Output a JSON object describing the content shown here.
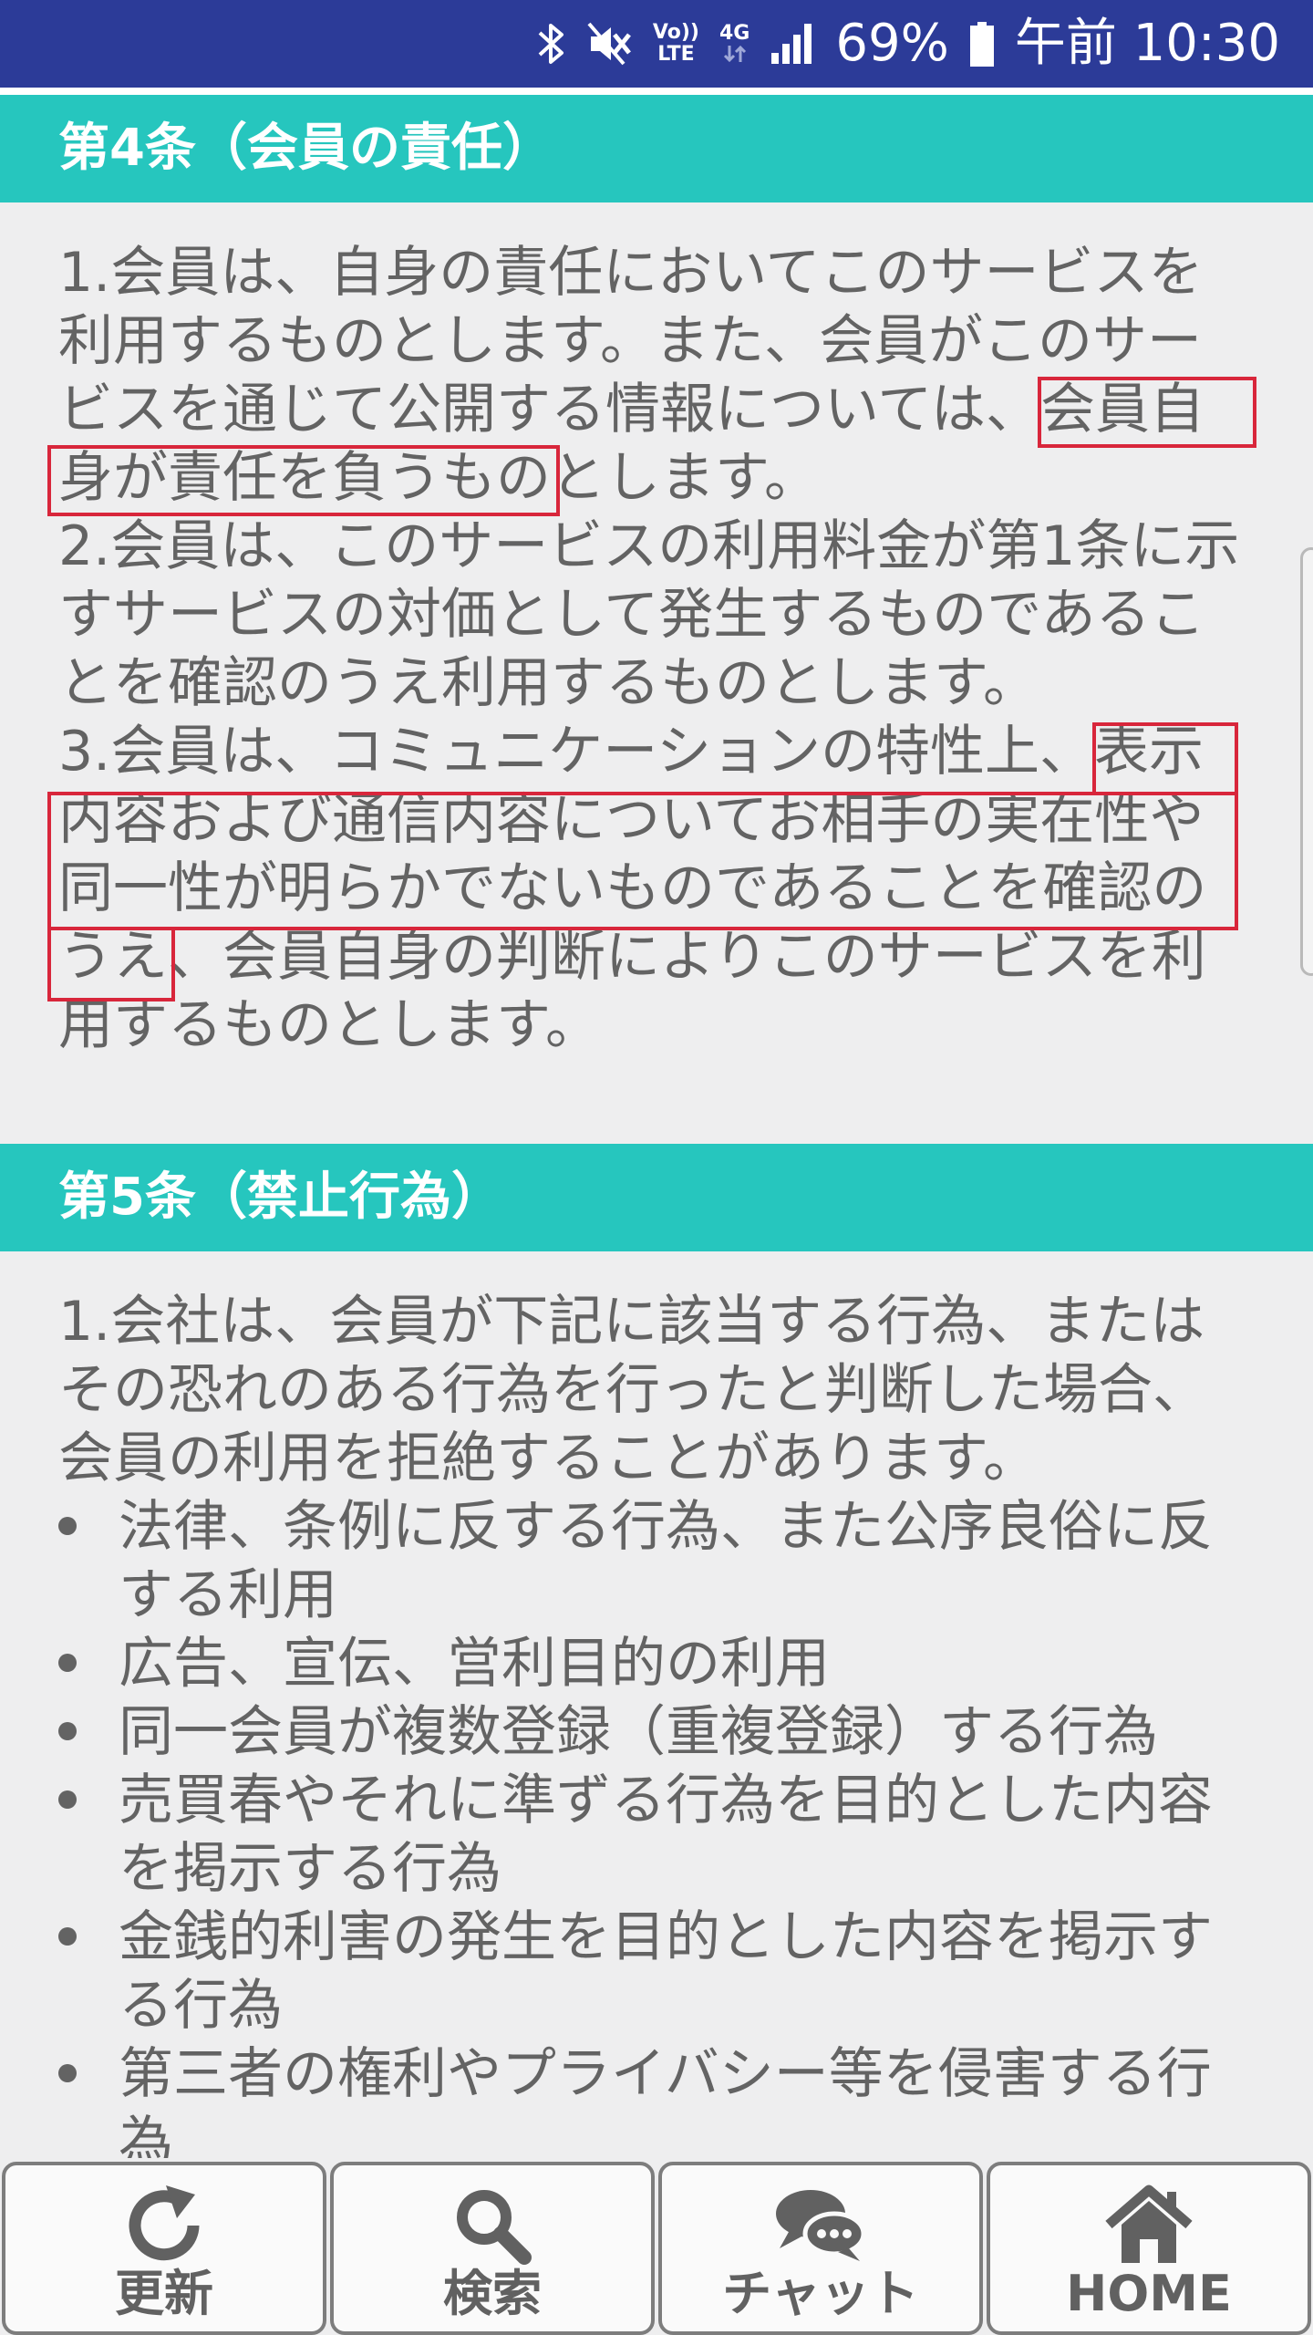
{
  "status_bar": {
    "network_vo": "Vo))",
    "network_lte": "LTE",
    "network_4g": "4G",
    "battery": "69%",
    "time": "午前 10:30",
    "icons": [
      "bluetooth-icon",
      "mute-icon",
      "volte-icon",
      "data-4g-icon",
      "signal-icon",
      "battery-icon"
    ]
  },
  "article4": {
    "title": "第4条（会員の責任）",
    "lines": [
      "1.会員は、自身の責任においてこのサービスを",
      "利用するものとします。また、会員がこのサー",
      "ビスを通じて公開する情報については、会員自",
      "身が責任を負うものとします。",
      "2.会員は、このサービスの利用料金が第1条に示",
      "すサービスの対価として発生するものであるこ",
      "とを確認のうえ利用するものとします。",
      "3.会員は、コミュニケーションの特性上、表示",
      "内容および通信内容についてお相手の実在性や",
      "同一性が明らかでないものであることを確認の",
      "うえ、会員自身の判断によりこのサービスを利",
      "用するものとします。"
    ]
  },
  "article5": {
    "title": "第5条（禁止行為）",
    "lines": [
      "1.会社は、会員が下記に該当する行為、または",
      "その恐れのある行為を行ったと判断した場合、",
      "会員の利用を拒絶することがあります。"
    ],
    "bullets": [
      [
        "法律、条例に反する行為、また公序良俗に反",
        "する利用"
      ],
      [
        "広告、宣伝、営利目的の利用"
      ],
      [
        "同一会員が複数登録（重複登録）する行為"
      ],
      [
        "売買春やそれに準ずる行為を目的とした内容",
        "を掲示する行為"
      ],
      [
        "金銭的利害の発生を目的とした内容を掲示す",
        "る行為"
      ],
      [
        "第三者の権利やプライバシー等を侵害する行",
        "為"
      ]
    ]
  },
  "bottom_nav": {
    "items": [
      {
        "label": "更新",
        "icon": "refresh-icon"
      },
      {
        "label": "検索",
        "icon": "search-icon"
      },
      {
        "label": "チャット",
        "icon": "chat-icon"
      },
      {
        "label": "HOME",
        "icon": "home-icon"
      }
    ]
  },
  "colors": {
    "status_bar": "#2c3b98",
    "section_header": "#26c6be",
    "body_text": "#636363",
    "highlight": "#d8263b",
    "background": "#eeeeef"
  }
}
